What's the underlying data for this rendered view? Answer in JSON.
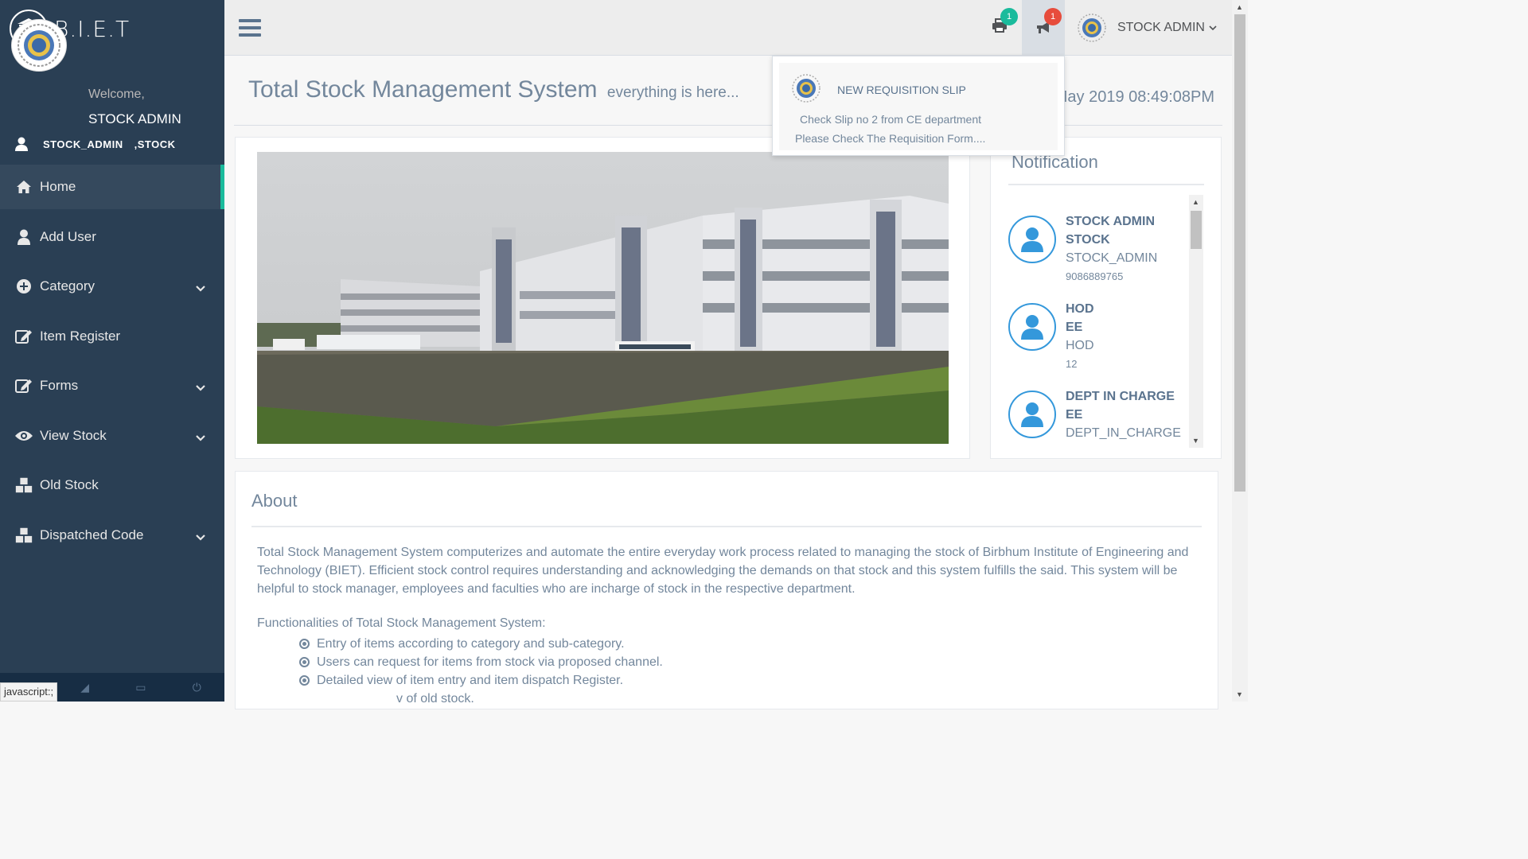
{
  "brand": {
    "name": "B.I.E.T"
  },
  "profile": {
    "welcome": "Welcome,",
    "name": "STOCK ADMIN",
    "username": "STOCK_ADMIN",
    "dept": ",STOCK"
  },
  "menu": [
    {
      "label": "Home",
      "icon": "home-icon",
      "active": true
    },
    {
      "label": "Add User",
      "icon": "user-icon"
    },
    {
      "label": "Category",
      "icon": "plus-circle-icon",
      "has_children": true
    },
    {
      "label": "Item Register",
      "icon": "edit-icon"
    },
    {
      "label": "Forms",
      "icon": "edit-icon",
      "has_children": true
    },
    {
      "label": "View Stock",
      "icon": "eye-icon",
      "has_children": true
    },
    {
      "label": "Old Stock",
      "icon": "cubes-icon"
    },
    {
      "label": "Dispatched Code",
      "icon": "cubes-icon",
      "has_children": true
    }
  ],
  "topnav": {
    "print_badge": "1",
    "bell_badge": "1",
    "user_label": "STOCK ADMIN"
  },
  "page": {
    "title": "Total Stock Management System",
    "subtitle": "everything is here...",
    "datetime": "May 2019 08:49:08PM"
  },
  "notifications": {
    "title": "Notification",
    "items": [
      {
        "line1": "STOCK ADMIN",
        "line2": "STOCK",
        "line3": "STOCK_ADMIN",
        "line4": "9086889765"
      },
      {
        "line1": "HOD",
        "line2": "EE",
        "line3": "HOD",
        "line4": "12"
      },
      {
        "line1": "DEPT IN CHARGE",
        "line2": "EE",
        "line3": "DEPT_IN_CHARGE",
        "line4": ""
      }
    ]
  },
  "dropdown": {
    "title": "NEW REQUISITION SLIP",
    "message1": "Check Slip no 2 from CE department",
    "message2": "Please Check The Requisition Form...."
  },
  "about": {
    "title": "About",
    "text": "Total Stock Management System computerizes and automate the entire everyday work process related to managing the stock of Birbhum Institute of Engineering and Technology (BIET). Efficient stock control requires understanding and acknowledging the demands on that stock and this system fulfills the said. This system will be helpful to stock manager, employees and faculties who are incharge of stock in the respective department.",
    "functionalities_title": "Functionalities of Total Stock Management System:",
    "functionalities": [
      "Entry of items according to category and sub-category.",
      "Users can request for items from stock via proposed channel.",
      "Detailed view of item entry and item dispatch Register.",
      "v of old stock."
    ]
  },
  "statusbar": {
    "text": "javascript:;"
  },
  "colors": {
    "sidebar": "#2a3f54",
    "accent": "#1abb9c",
    "badge_red": "#e74c3c",
    "avatar_blue": "#3498db"
  }
}
